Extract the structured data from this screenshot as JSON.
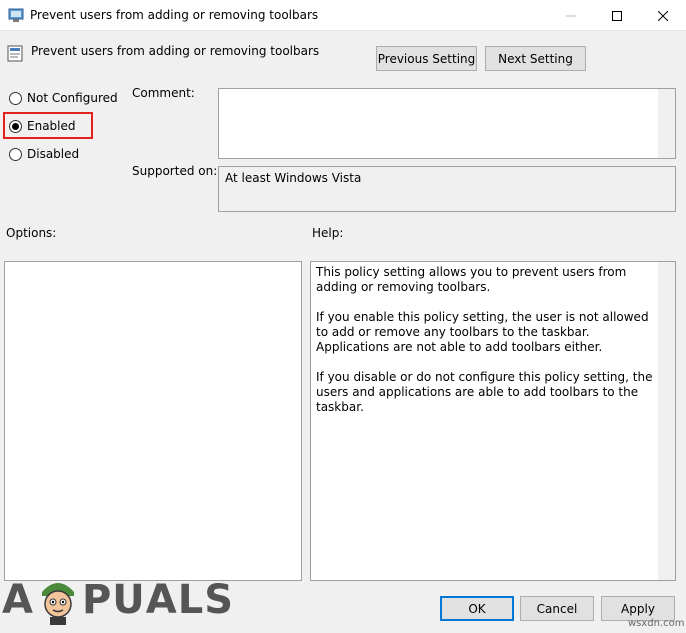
{
  "window": {
    "title": "Prevent users from adding or removing toolbars",
    "controls": [
      "minimize",
      "maximize",
      "close"
    ]
  },
  "header": {
    "setting_title": "Prevent users from adding or removing toolbars",
    "previous_label": "Previous Setting",
    "next_label": "Next Setting"
  },
  "state": {
    "options": [
      {
        "label": "Not Configured",
        "checked": false
      },
      {
        "label": "Enabled",
        "checked": true
      },
      {
        "label": "Disabled",
        "checked": false
      }
    ],
    "highlight_color": "#e0211d"
  },
  "comment": {
    "label": "Comment:",
    "value": ""
  },
  "supported": {
    "label": "Supported on:",
    "value": "At least Windows Vista"
  },
  "options_pane": {
    "label": "Options:"
  },
  "help": {
    "label": "Help:",
    "paragraphs": [
      "This policy setting allows you to prevent users from adding or removing toolbars.",
      "If you enable this policy setting, the user is not allowed to add or remove any toolbars to the taskbar. Applications are not able to add toolbars either.",
      "If you disable or do not configure this policy setting, the users and applications are able to add toolbars to the taskbar."
    ]
  },
  "footer": {
    "ok_label": "OK",
    "cancel_label": "Cancel",
    "apply_label": "Apply"
  },
  "watermark": {
    "letters": [
      "A",
      "P",
      "U",
      "A",
      "L",
      "S"
    ],
    "site": "wsxdn.com"
  },
  "colors": {
    "accent": "#0078d7",
    "dialog_bg": "#f0f0f0"
  }
}
